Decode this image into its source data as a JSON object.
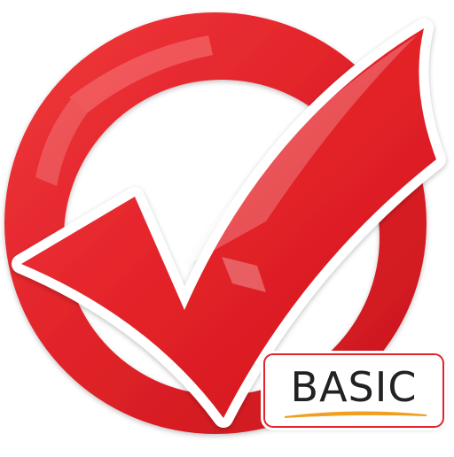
{
  "icon": {
    "name": "red-checkmark-icon",
    "ring_color": "#e2242a",
    "ring_highlight": "#f26a6a",
    "check_color": "#e52229",
    "outline_color": "#ffffff"
  },
  "badge": {
    "label": "BASIC",
    "border_color": "#e2242a",
    "swoosh_color": "#f0a020"
  }
}
